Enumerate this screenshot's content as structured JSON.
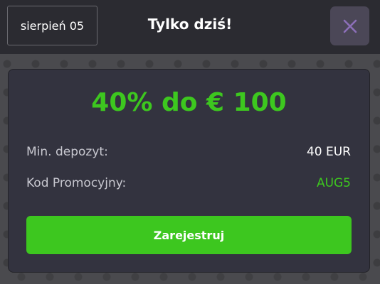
{
  "header": {
    "date_badge": "sierpień 05",
    "title": "Tylko dziś!",
    "close_icon": "close-icon"
  },
  "card": {
    "offer": "40% do € 100",
    "rows": [
      {
        "label": "Min. depozyt:",
        "value": "40 EUR"
      },
      {
        "label": "Kod Promocyjny:",
        "value": "AUG5"
      }
    ],
    "register_label": "Zarejestruj"
  },
  "colors": {
    "accent_green": "#3dc71f",
    "header_bg": "#2b2b31",
    "card_bg": "#33333f",
    "close_button_bg": "#4b4757",
    "close_icon": "#8c6fb8"
  }
}
